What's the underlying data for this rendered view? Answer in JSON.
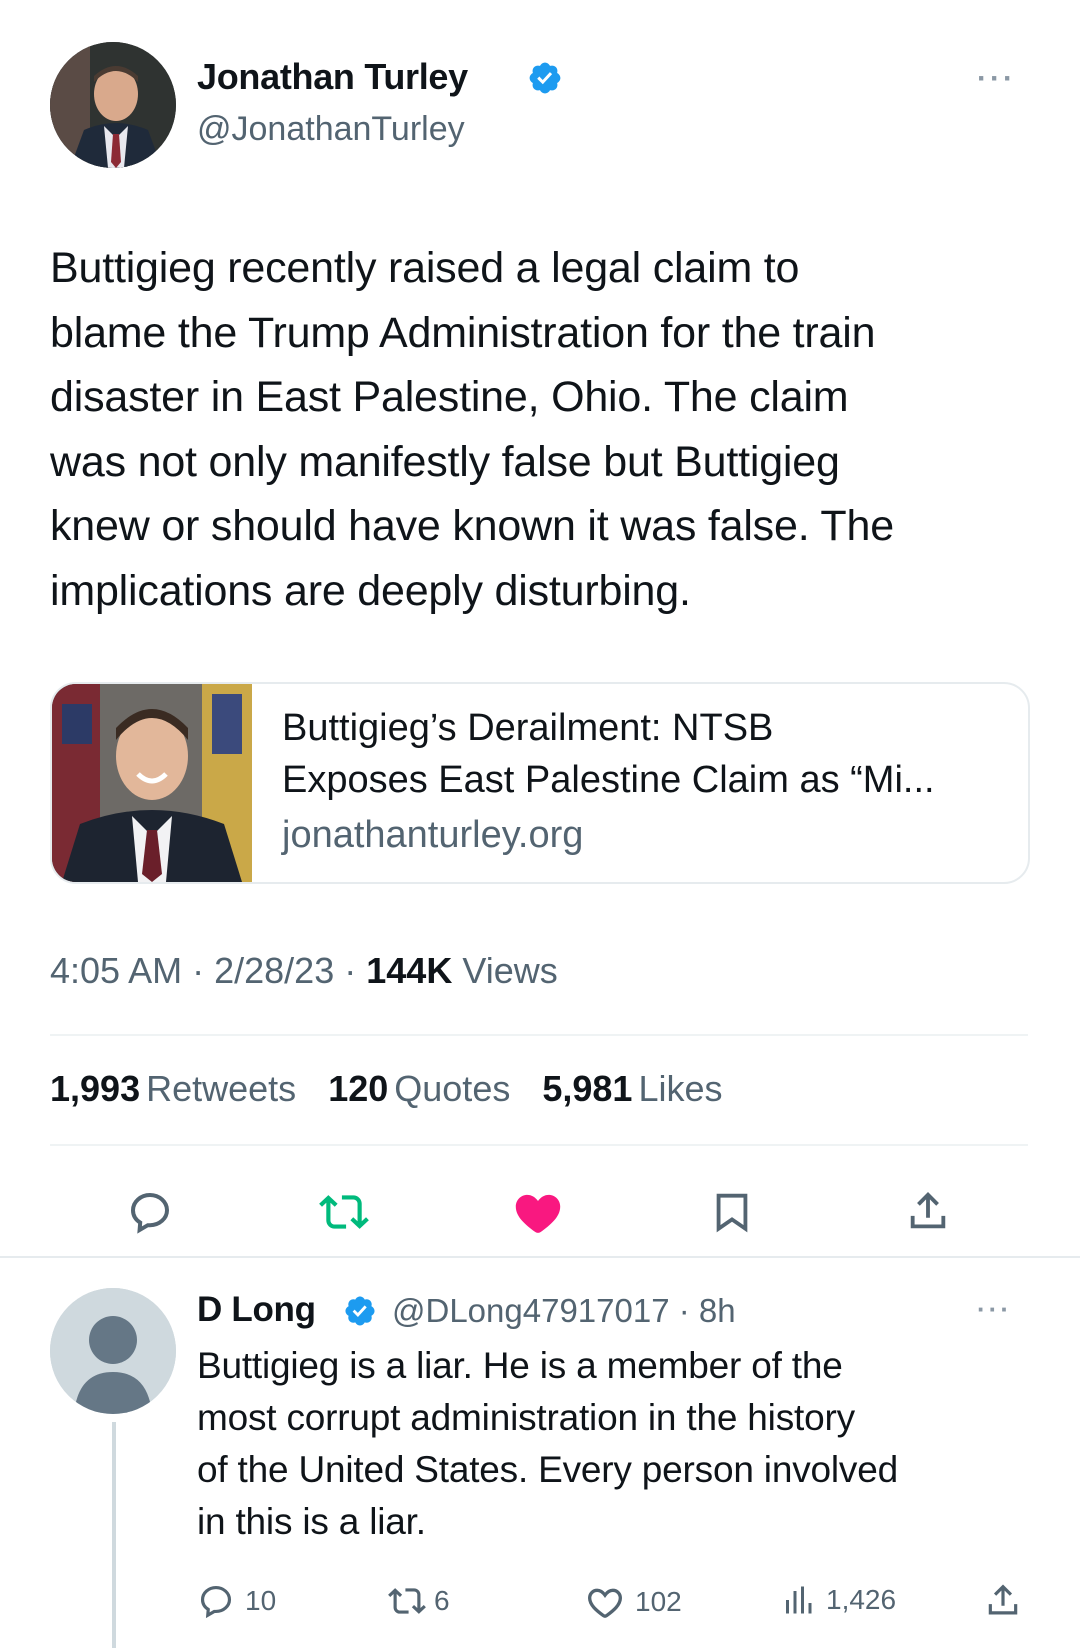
{
  "tweet": {
    "author_name": "Jonathan Turley",
    "author_handle": "@JonathanTurley",
    "text_lines": [
      "Buttigieg recently raised a legal claim to",
      "blame the Trump Administration for the train",
      "disaster in East Palestine, Ohio. The claim",
      "was not only manifestly false but Buttigieg",
      "knew or should have known it was false. The",
      "implications are deeply disturbing."
    ],
    "card": {
      "title_line1": "Buttigieg’s Derailment: NTSB",
      "title_line2": "Exposes East Palestine Claim as “Mi...",
      "domain": "jonathanturley.org"
    },
    "time": "4:05 AM",
    "date": "2/28/23",
    "views_count": "144K",
    "views_label": "Views",
    "retweets_count": "1,993",
    "retweets_label": "Retweets",
    "quotes_count": "120",
    "quotes_label": "Quotes",
    "likes_count": "5,981",
    "likes_label": "Likes",
    "icons": [
      "reply-icon",
      "retweet-icon",
      "like-icon-filled",
      "bookmark-icon",
      "share-icon"
    ],
    "colors": {
      "retweet": "#00ba7c",
      "like": "#f91880",
      "verified": "#1d9bf0"
    }
  },
  "reply": {
    "author_name": "D Long",
    "author_handle": "@DLong47917017",
    "age": "8h",
    "text_lines": [
      "Buttigieg is a liar. He is a member of the",
      "most corrupt administration in the history",
      "of the United States. Every person involved",
      "in this is a liar."
    ],
    "replies": "10",
    "retweets": "6",
    "likes": "102",
    "views": "1,426"
  }
}
